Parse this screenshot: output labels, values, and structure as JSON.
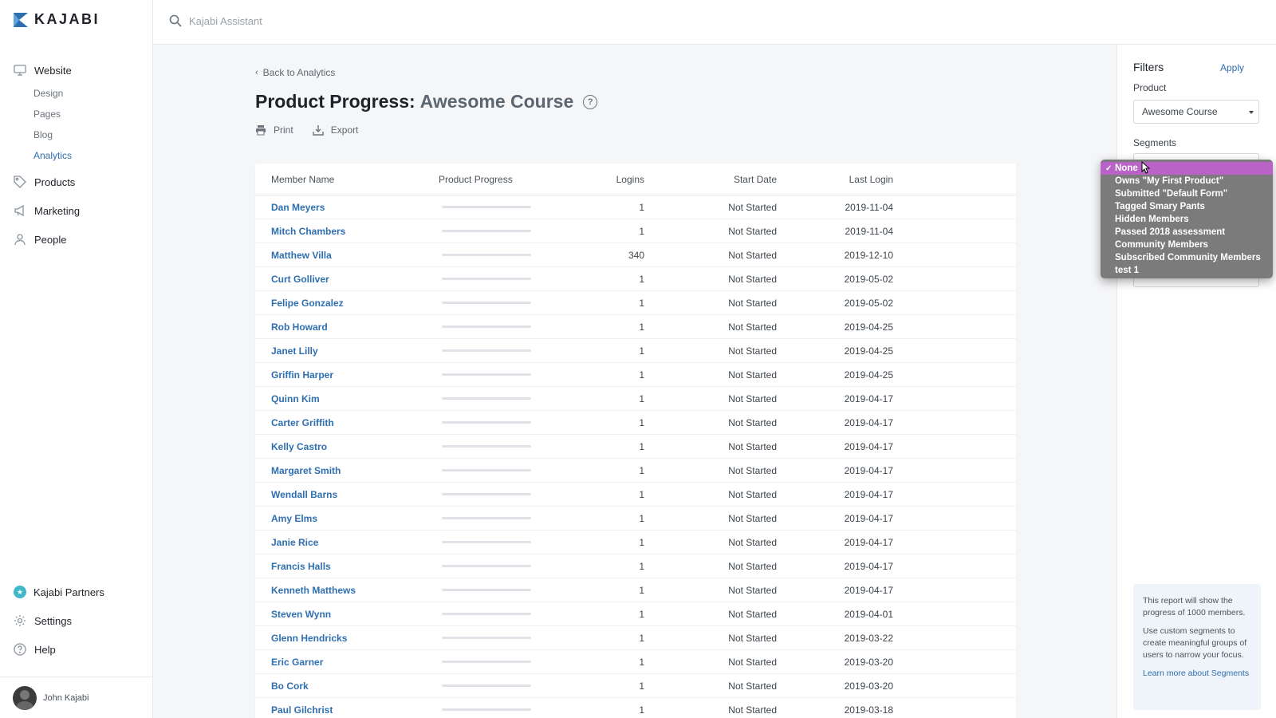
{
  "app": {
    "logo": "KAJABI",
    "brand_color": "#2f6fb0"
  },
  "search": {
    "placeholder": "Kajabi Assistant",
    "icon": "search-icon"
  },
  "sidebar": {
    "website": "Website",
    "sub": [
      "Design",
      "Pages",
      "Blog",
      "Analytics"
    ],
    "active_sub": "Analytics",
    "products": "Products",
    "marketing": "Marketing",
    "people": "People",
    "partners": "Kajabi Partners",
    "settings": "Settings",
    "help": "Help",
    "user": "John Kajabi"
  },
  "page": {
    "back": "Back to Analytics",
    "title_prefix": "Product Progress:",
    "title_course": "Awesome Course",
    "print": "Print",
    "export": "Export"
  },
  "table": {
    "headers": [
      "Member Name",
      "Product Progress",
      "Logins",
      "Start Date",
      "Last Login"
    ],
    "rows": [
      {
        "name": "Dan Meyers",
        "progress": 0,
        "logins": "1",
        "start": "Not Started",
        "last": "2019-11-04"
      },
      {
        "name": "Mitch Chambers",
        "progress": 0,
        "logins": "1",
        "start": "Not Started",
        "last": "2019-11-04"
      },
      {
        "name": "Matthew Villa",
        "progress": 0,
        "logins": "340",
        "start": "Not Started",
        "last": "2019-12-10"
      },
      {
        "name": "Curt Golliver",
        "progress": 0,
        "logins": "1",
        "start": "Not Started",
        "last": "2019-05-02"
      },
      {
        "name": "Felipe Gonzalez",
        "progress": 0,
        "logins": "1",
        "start": "Not Started",
        "last": "2019-05-02"
      },
      {
        "name": "Rob Howard",
        "progress": 0,
        "logins": "1",
        "start": "Not Started",
        "last": "2019-04-25"
      },
      {
        "name": "Janet Lilly",
        "progress": 0,
        "logins": "1",
        "start": "Not Started",
        "last": "2019-04-25"
      },
      {
        "name": "Griffin Harper",
        "progress": 0,
        "logins": "1",
        "start": "Not Started",
        "last": "2019-04-25"
      },
      {
        "name": "Quinn Kim",
        "progress": 0,
        "logins": "1",
        "start": "Not Started",
        "last": "2019-04-17"
      },
      {
        "name": "Carter Griffith",
        "progress": 0,
        "logins": "1",
        "start": "Not Started",
        "last": "2019-04-17"
      },
      {
        "name": "Kelly Castro",
        "progress": 0,
        "logins": "1",
        "start": "Not Started",
        "last": "2019-04-17"
      },
      {
        "name": "Margaret Smith",
        "progress": 0,
        "logins": "1",
        "start": "Not Started",
        "last": "2019-04-17"
      },
      {
        "name": "Wendall Barns",
        "progress": 0,
        "logins": "1",
        "start": "Not Started",
        "last": "2019-04-17"
      },
      {
        "name": "Amy Elms",
        "progress": 0,
        "logins": "1",
        "start": "Not Started",
        "last": "2019-04-17"
      },
      {
        "name": "Janie Rice",
        "progress": 0,
        "logins": "1",
        "start": "Not Started",
        "last": "2019-04-17"
      },
      {
        "name": "Francis Halls",
        "progress": 0,
        "logins": "1",
        "start": "Not Started",
        "last": "2019-04-17"
      },
      {
        "name": "Kenneth Matthews",
        "progress": 0,
        "logins": "1",
        "start": "Not Started",
        "last": "2019-04-17"
      },
      {
        "name": "Steven Wynn",
        "progress": 0,
        "logins": "1",
        "start": "Not Started",
        "last": "2019-04-01"
      },
      {
        "name": "Glenn Hendricks",
        "progress": 0,
        "logins": "1",
        "start": "Not Started",
        "last": "2019-03-22"
      },
      {
        "name": "Eric Garner",
        "progress": 0,
        "logins": "1",
        "start": "Not Started",
        "last": "2019-03-20"
      },
      {
        "name": "Bo Cork",
        "progress": 0,
        "logins": "1",
        "start": "Not Started",
        "last": "2019-03-20"
      },
      {
        "name": "Paul Gilchrist",
        "progress": 0,
        "logins": "1",
        "start": "Not Started",
        "last": "2019-03-18"
      }
    ]
  },
  "filters": {
    "title": "Filters",
    "apply": "Apply",
    "product_label": "Product",
    "product_value": "Awesome Course",
    "segments_label": "Segments",
    "segment_options": [
      "None",
      "Owns \"My First Product\"",
      "Submitted \"Default Form\"",
      "Tagged Smary Pants",
      "Hidden Members",
      "Passed 2018 assessment",
      "Community Members",
      "Subscribed Community Members",
      "test 1"
    ],
    "selected_segment_index": 0,
    "info_1": "This report will show the progress of 1000 members.",
    "info_2": "Use custom segments to create meaningful groups of users to narrow your focus.",
    "info_link": "Learn more about Segments"
  }
}
